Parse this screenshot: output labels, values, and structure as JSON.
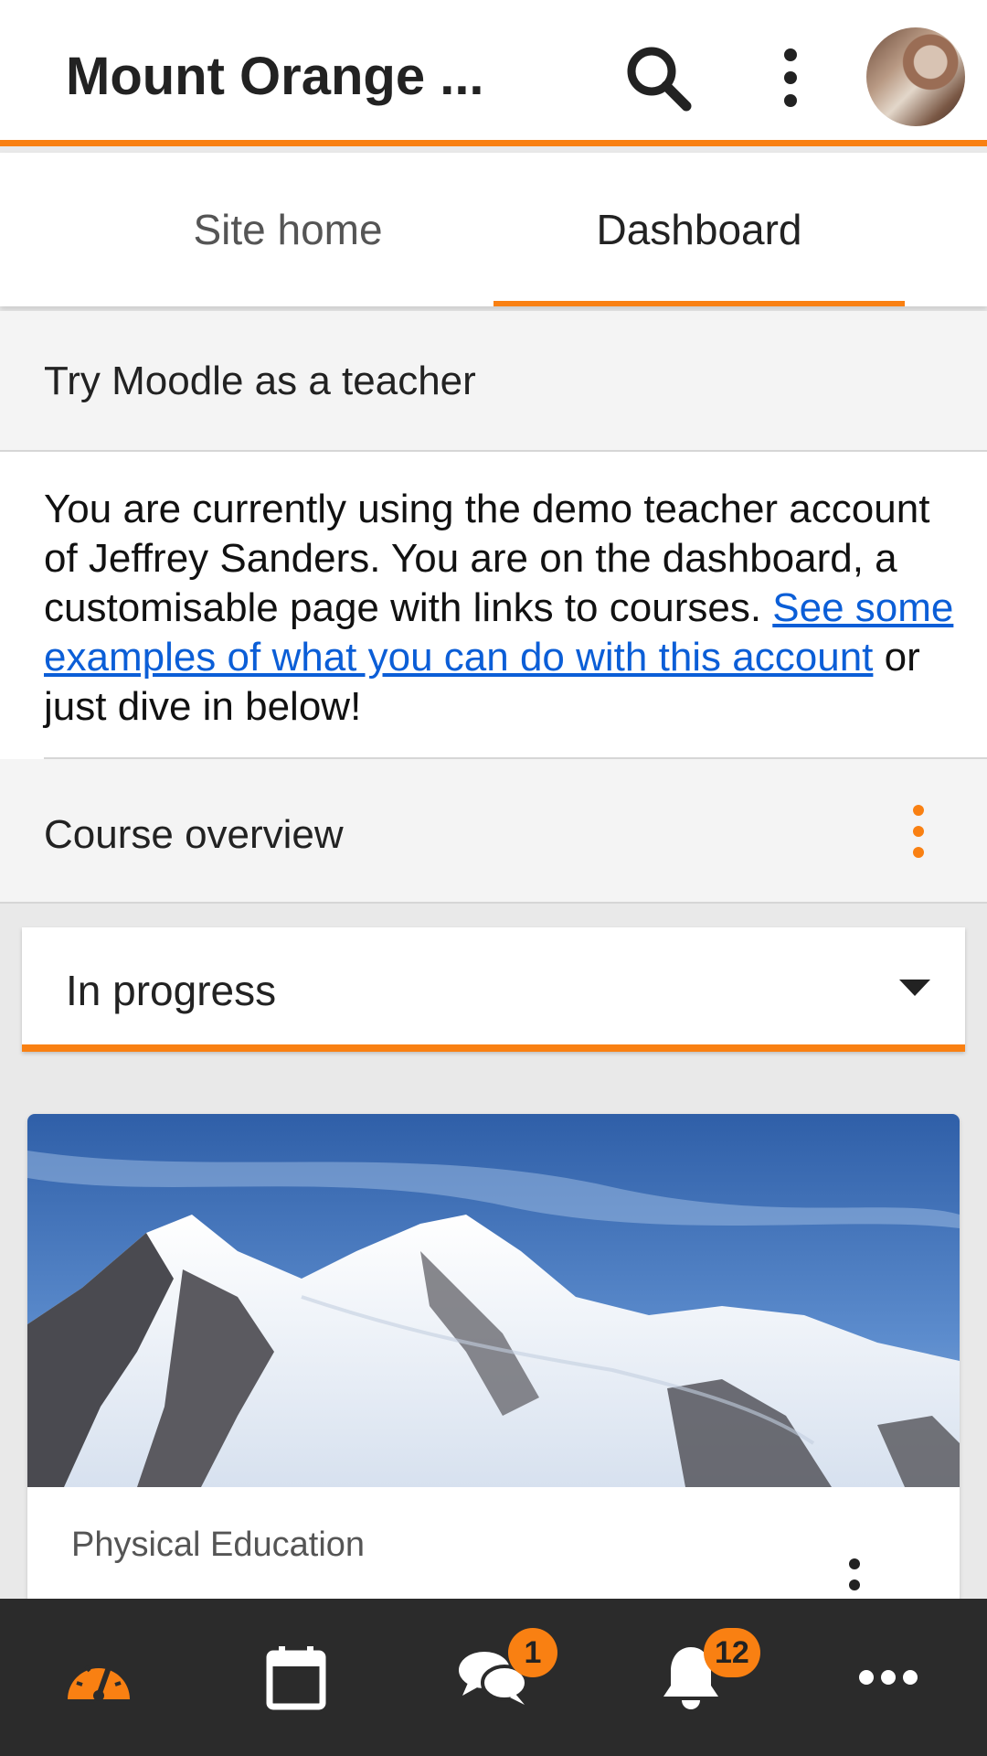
{
  "header": {
    "site_title": "Mount Orange ...",
    "search_icon": "search-icon",
    "more_icon": "vertical-ellipsis-icon",
    "avatar_alt": "user-avatar"
  },
  "tabs": [
    {
      "label": "Site home",
      "active": false
    },
    {
      "label": "Dashboard",
      "active": true
    }
  ],
  "teacher_block": {
    "title": "Try Moodle as a teacher",
    "body_before_link": "You are currently using the demo teacher account of Jeffrey Sanders. You are on the dashboard, a customisable page with links to courses. ",
    "link_text": "See some examples of what you can do with this account",
    "body_after_link": " or just dive in below!"
  },
  "course_overview": {
    "title": "Course overview",
    "filter_value": "In progress",
    "courses": [
      {
        "category": "Physical Education"
      }
    ]
  },
  "bottom_nav": {
    "items": [
      {
        "icon": "dashboard-gauge-icon",
        "active": true
      },
      {
        "icon": "calendar-icon",
        "active": false
      },
      {
        "icon": "messages-icon",
        "badge": "1"
      },
      {
        "icon": "bell-icon",
        "badge": "12"
      },
      {
        "icon": "more-horizontal-icon",
        "active": false
      }
    ]
  },
  "colors": {
    "accent": "#f98012",
    "nav_bg": "#2b2b2b",
    "link": "#0b5ed7"
  }
}
